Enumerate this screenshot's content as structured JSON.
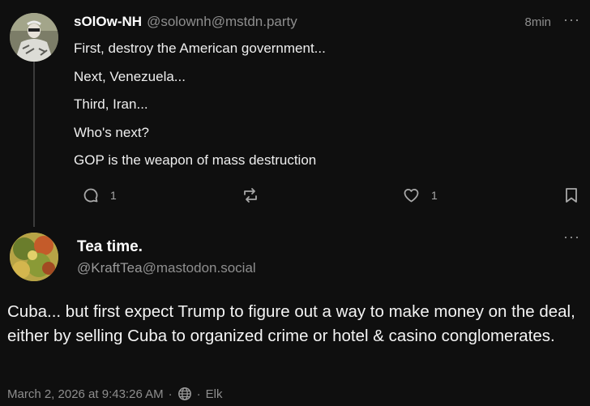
{
  "parent_post": {
    "display_name": "sOlOw-NH",
    "handle": "@solownh@mstdn.party",
    "time": "8min",
    "lines": [
      "First, destroy the American government...",
      "Next,  Venezuela...",
      "Third, Iran...",
      "Who's next?",
      "GOP is the weapon of mass destruction"
    ],
    "actions": {
      "reply_count": "1",
      "favourite_count": "1"
    },
    "more_icon": "more-icon",
    "icons": [
      "reply-icon",
      "boost-icon",
      "favourite-icon",
      "bookmark-icon"
    ]
  },
  "main_post": {
    "display_name": "Tea time.",
    "handle_user": "@KraftTea",
    "handle_server": "@mastodon.social",
    "body": "Cuba... but first expect Trump to figure out a way to make money on the deal, either by selling Cuba to organized crime or hotel & casino conglomerates.",
    "date": "March 2, 2026 at 9:43:26 AM",
    "separator": "·",
    "client": "Elk",
    "visibility_icon": "globe-icon"
  },
  "colors": {
    "background": "#0f0f0f",
    "text": "#f2f2f2",
    "muted": "#8e8e8e",
    "thread_line": "#3b3b3b"
  }
}
